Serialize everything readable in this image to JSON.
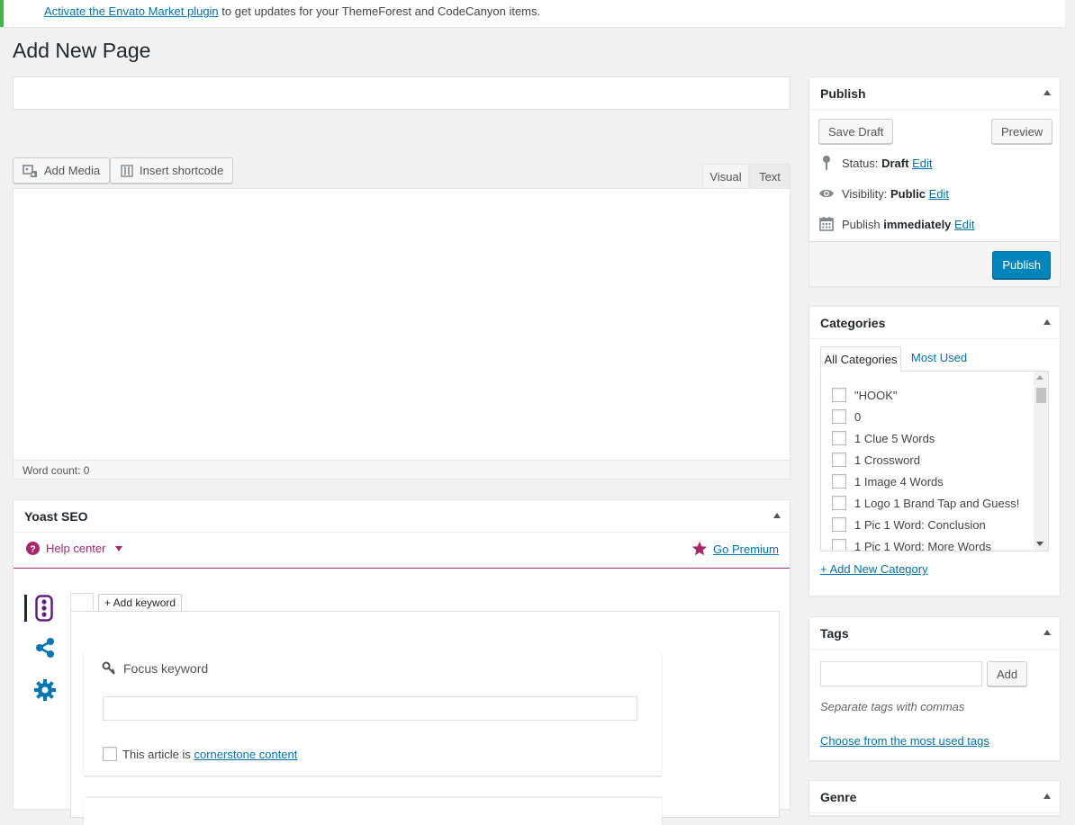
{
  "notice": {
    "link": "Activate the Envato Market plugin",
    "text": " to get updates for your ThemeForest and CodeCanyon items."
  },
  "page_title": "Add New Page",
  "title_input": {
    "value": "",
    "placeholder": ""
  },
  "media_buttons": {
    "add_media": "Add Media",
    "insert_shortcode": "Insert shortcode"
  },
  "editor_tabs": {
    "visual": "Visual",
    "text": "Text",
    "active": "Visual"
  },
  "word_count": "Word count: 0",
  "yoast": {
    "title": "Yoast SEO",
    "help_center": "Help center",
    "go_premium": "Go Premium",
    "add_keyword": "+ Add keyword",
    "focus_keyword": "Focus keyword",
    "cornerstone_prefix": "This article is ",
    "cornerstone_link": "cornerstone content",
    "focus_input_value": "",
    "accent_color": "#a4286a",
    "icon_blue": "#0075b3"
  },
  "publish": {
    "title": "Publish",
    "save_draft": "Save Draft",
    "preview": "Preview",
    "status_label": "Status:",
    "status_value": "Draft",
    "visibility_label": "Visibility:",
    "visibility_value": "Public",
    "publish_label": "Publish",
    "publish_value": "immediately",
    "edit": "Edit",
    "publish_button": "Publish"
  },
  "categories": {
    "title": "Categories",
    "tab_all": "All Categories",
    "tab_most_used": "Most Used",
    "items": [
      "\"HOOK\"",
      "0",
      "1 Clue 5 Words",
      "1 Crossword",
      "1 Image 4 Words",
      "1 Logo 1 Brand Tap and Guess!",
      "1 Pic 1 Word: Conclusion",
      "1 Pic 1 Word: More Words"
    ],
    "add_new": "+ Add New Category"
  },
  "tags": {
    "title": "Tags",
    "input_value": "",
    "add_button": "Add",
    "hint": "Separate tags with commas",
    "choose_link": "Choose from the most used tags"
  },
  "genre": {
    "title": "Genre"
  }
}
